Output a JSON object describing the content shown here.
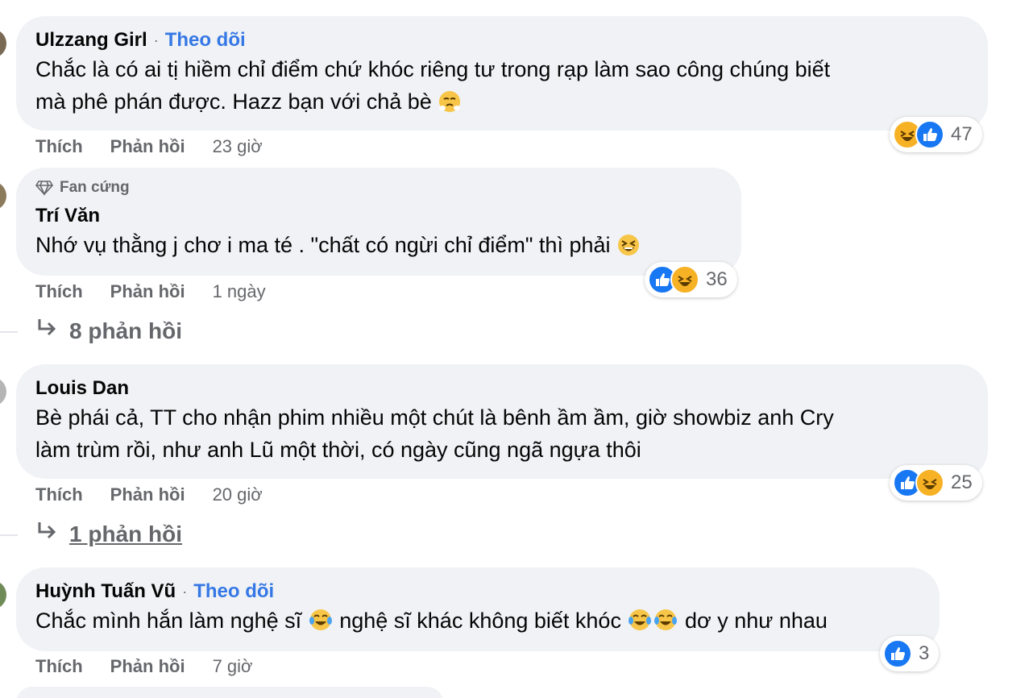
{
  "comments": [
    {
      "author": "Ulzzang Girl",
      "follow": "Theo dõi",
      "text": "Chắc là có ai tị hiềm chỉ điểm chứ khóc riêng tư trong rạp làm sao công chúng biết\nmà phê phán được. Hazz bạn với chả bè",
      "like": "Thích",
      "reply": "Phản hồi",
      "time": "23 giờ",
      "reaction_count": "47"
    },
    {
      "badge": "Fan cứng",
      "author": "Trí Văn",
      "text": "Nhớ vụ thằng j chơ i ma té . \"chất có ngừi chỉ điểm\" thì phải",
      "like": "Thích",
      "reply": "Phản hồi",
      "time": "1 ngày",
      "reaction_count": "36",
      "replies": "8 phản hồi"
    },
    {
      "author": "Louis Dan",
      "text": "Bè phái cả, TT cho nhận phim nhiều một chút là bênh ầm ầm, giờ showbiz anh Cry\nlàm trùm rồi, như anh Lũ một thời, có ngày cũng ngã ngựa thôi",
      "like": "Thích",
      "reply": "Phản hồi",
      "time": "20 giờ",
      "reaction_count": "25",
      "replies": "1 phản hồi"
    },
    {
      "author": "Huỳnh Tuấn Vũ",
      "follow": "Theo dõi",
      "text_a": "Chắc mình hắn làm nghệ sĩ",
      "text_b": "nghệ sĩ khác không biết khóc",
      "text_c": "dơ y như nhau",
      "like": "Thích",
      "reply": "Phản hồi",
      "time": "7 giờ",
      "reaction_count": "3"
    }
  ],
  "colors": {
    "link": "#3578e5",
    "like": "#1877f2",
    "haha": "#f7b125",
    "bubble": "#f0f2f5",
    "muted": "#65676b"
  },
  "icons": [
    "like-icon",
    "haha-icon",
    "fan-badge-icon",
    "reply-arrow-icon",
    "tears-of-joy-emoji",
    "huffing-emoji",
    "grinning-squint-emoji"
  ]
}
